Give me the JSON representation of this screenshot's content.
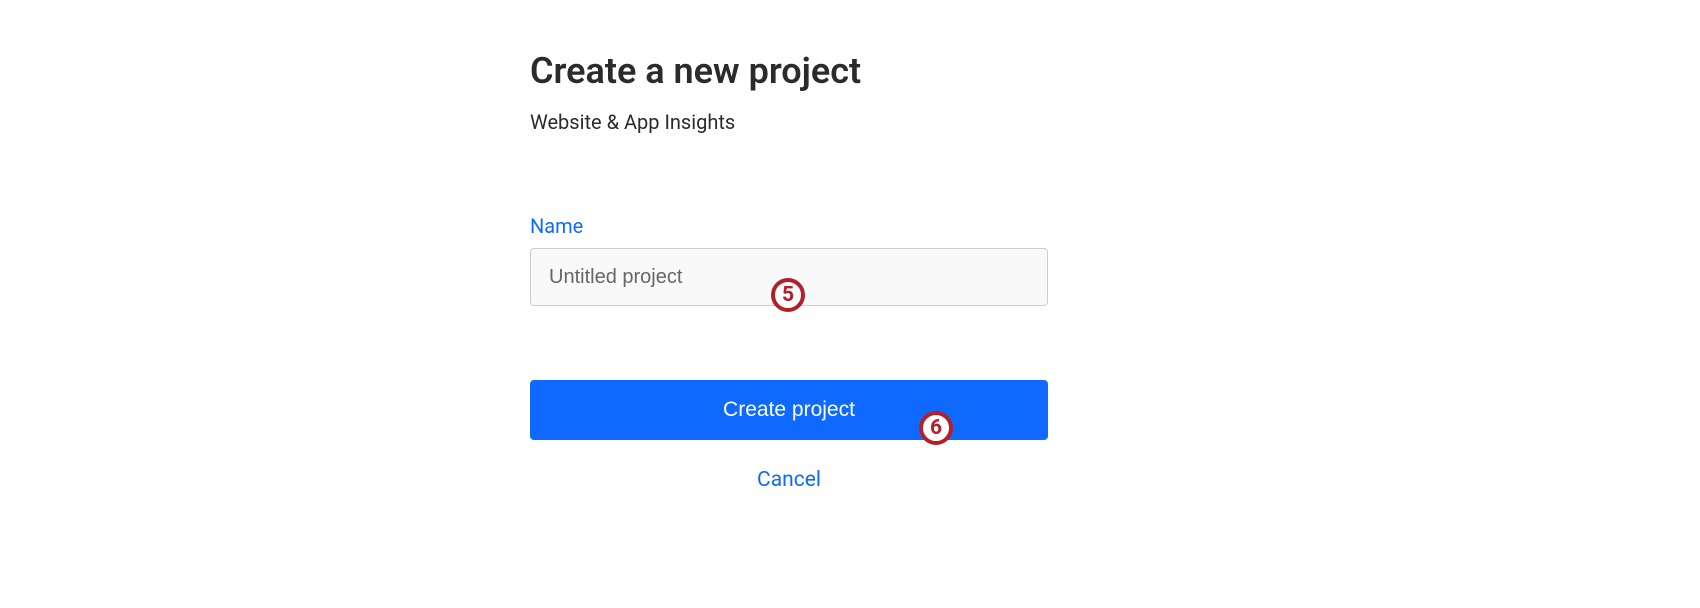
{
  "header": {
    "title": "Create a new project",
    "subtitle": "Website & App Insights"
  },
  "form": {
    "name_label": "Name",
    "name_placeholder": "Untitled project"
  },
  "actions": {
    "create_label": "Create project",
    "cancel_label": "Cancel"
  },
  "annotations": {
    "badge_5": "5",
    "badge_6": "6"
  }
}
